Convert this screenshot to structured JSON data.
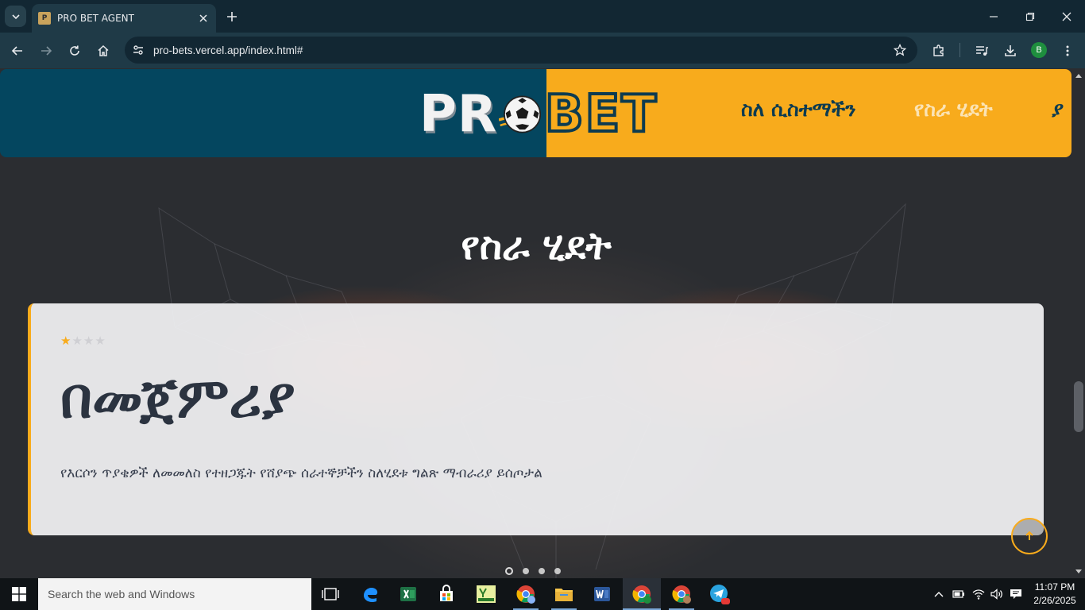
{
  "browser": {
    "tab_title": "PRO BET AGENT",
    "url": "pro-bets.vercel.app/index.html#",
    "profile_initial": "B"
  },
  "header": {
    "logo_left": "PR",
    "logo_right": "BET",
    "nav": [
      {
        "label": "ስለ ሲስተማችን"
      },
      {
        "label": "የስራ ሂደት"
      },
      {
        "label": "ያ"
      }
    ]
  },
  "section": {
    "title": "የስራ ሂደት"
  },
  "card": {
    "rating": 1,
    "rating_max": 4,
    "heading": "በመጀምሪያ",
    "text": "የእርሶን ጥያቄዎች ለመመለስ የተዘጋጁት የሸያጭ ሰራተኞቻችን ስለሂደቱ ግልጽ ማብራሪያ ይሰጦታል"
  },
  "carousel": {
    "slide_count": 4,
    "active_index": 0
  },
  "taskbar": {
    "search_placeholder": "Search the web and Windows",
    "time": "11:07 PM",
    "date": "2/26/2025"
  },
  "colors": {
    "brand_dark": "#04465f",
    "brand_accent": "#f8ab1c",
    "page_bg": "#2b2d31"
  }
}
